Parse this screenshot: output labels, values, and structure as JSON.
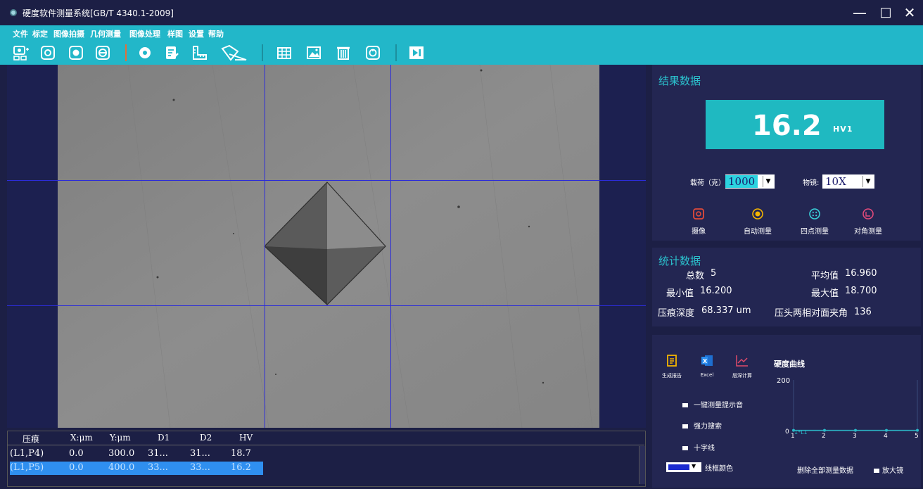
{
  "window": {
    "title": "硬度软件测量系统[GB/T 4340.1-2009]",
    "minimize": "—",
    "maximize": "□",
    "close": "✕"
  },
  "menu": [
    "文件",
    "标定",
    "图像拍摄",
    "几何测量",
    "图像处理",
    "样图",
    "设置",
    "帮助"
  ],
  "toolbar_icons": [
    "camera-settings-icon",
    "camera-icon",
    "record-icon",
    "capture-icon",
    "marker-icon",
    "note-edit-icon",
    "ruler-icon",
    "measure-shape-icon",
    "table-icon",
    "image-icon",
    "delete-icon",
    "reset-icon",
    "play-icon"
  ],
  "table": {
    "headers": [
      "压痕",
      "X:μm",
      "Y:μm",
      "D1",
      "D2",
      "HV"
    ],
    "rows": [
      {
        "id": "(L1,P4)",
        "x": "0.0",
        "y": "300.0",
        "d1": "31...",
        "d2": "31...",
        "hv": "18.7",
        "selected": false
      },
      {
        "id": "(L1,P5)",
        "x": "0.0",
        "y": "400.0",
        "d1": "33...",
        "d2": "33...",
        "hv": "16.2",
        "selected": true
      }
    ]
  },
  "results": {
    "title": "结果数据",
    "value": "16.2",
    "unit": "HV1",
    "load_label": "载荷（克）:",
    "load_value": "1000",
    "objective_label": "物镜:",
    "objective_value": "10X",
    "modes": [
      "摄像",
      "自动测量",
      "四点测量",
      "对角测量"
    ]
  },
  "stats": {
    "title": "统计数据",
    "total_label": "总数",
    "total_value": "5",
    "avg_label": "平均值",
    "avg_value": "16.960",
    "min_label": "最小值",
    "min_value": "16.200",
    "max_label": "最大值",
    "max_value": "18.700",
    "depth_label": "压痕深度",
    "depth_value": "68.337 um",
    "angle_label": "压头两相对面夹角",
    "angle_value": "136"
  },
  "actions": {
    "report": "生成报告",
    "excel": "Excel",
    "layer_calc": "层深计算",
    "curve_title": "硬度曲线",
    "option1": "一键测量提示音",
    "option2": "强力搜索",
    "option3": "十字线",
    "frame_color": "线框颜色",
    "delete_all": "删除全部测量数据",
    "magnifier": "放大镜"
  },
  "colors": {
    "accent": "#22b7c9",
    "panel": "#232652",
    "background": "#1c1f45",
    "selection": "#2f8ff0",
    "crosshair": "#2c2cd8"
  },
  "chart_data": {
    "type": "line",
    "title": "硬度曲线",
    "ylim": [
      0,
      200
    ],
    "y_ticks": [
      "200",
      "0"
    ],
    "x_ticks": [
      "1*L1",
      "1",
      "2",
      "3",
      "4",
      "5"
    ],
    "series": [
      {
        "values": [
          1,
          1,
          1,
          1,
          1
        ]
      }
    ]
  }
}
